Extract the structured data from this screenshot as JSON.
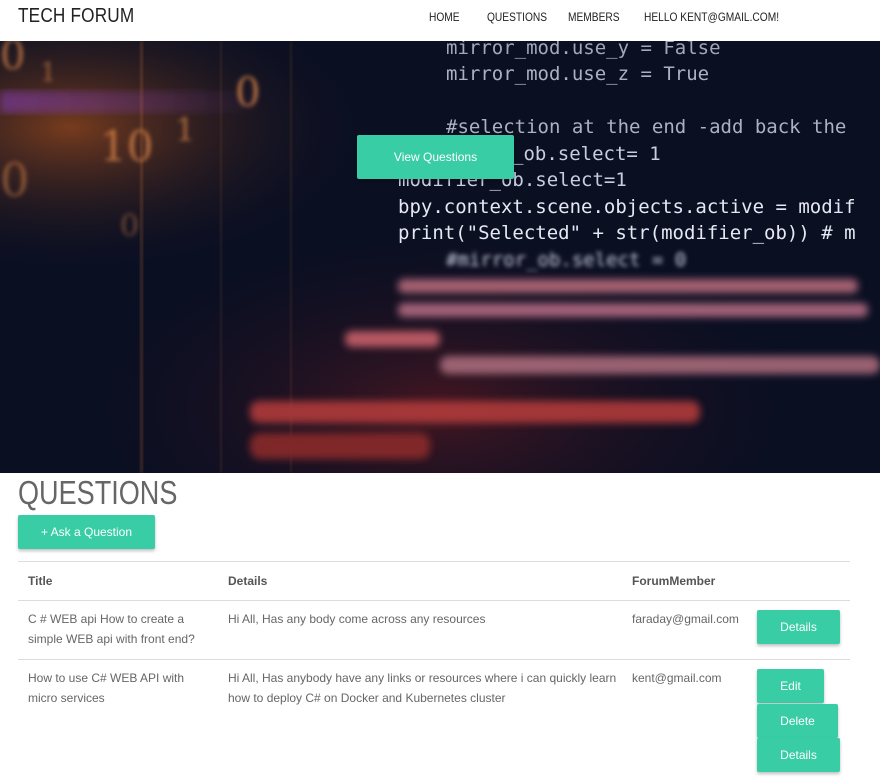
{
  "navbar": {
    "brand": "TECH FORUM",
    "links": [
      "HOME",
      "QUESTIONS",
      "MEMBERS",
      "HELLO KENT@GMAIL.COM!"
    ]
  },
  "hero": {
    "button_label": "View Questions",
    "code_lines": [
      "mirror_mod.use_y = False",
      "mirror_mod.use_z = True",
      "#selection at the end -add back the",
      "_ob.select= 1",
      "modifier_ob.select=1",
      "bpy.context.scene.objects.active = modif",
      "print(\"Selected\" + str(modifier_ob)) # m",
      "#mirror_ob.select = 0"
    ],
    "binary_digits": [
      "0",
      "1",
      "0",
      "10",
      "1",
      "0",
      "0"
    ]
  },
  "questions": {
    "title": "QUESTIONS",
    "ask_button": "+ Ask a Question",
    "columns": [
      "Title",
      "Details",
      "ForumMember"
    ],
    "rows": [
      {
        "title": "C # WEB api How to create a simple WEB api with front end?",
        "details": "Hi All, Has any body come across any resources",
        "member": "faraday@gmail.com",
        "actions": [
          "Details"
        ]
      },
      {
        "title": "How to use C# WEB API with micro services",
        "details": "Hi All, Has anybody have any links or resources where i can quickly learn how to deploy C# on Docker and Kubernetes cluster",
        "member": "kent@gmail.com",
        "actions": [
          "Edit",
          "Delete",
          "Details"
        ]
      }
    ]
  },
  "colors": {
    "accent": "#38cda4",
    "hero_background": "#0a0f22"
  }
}
